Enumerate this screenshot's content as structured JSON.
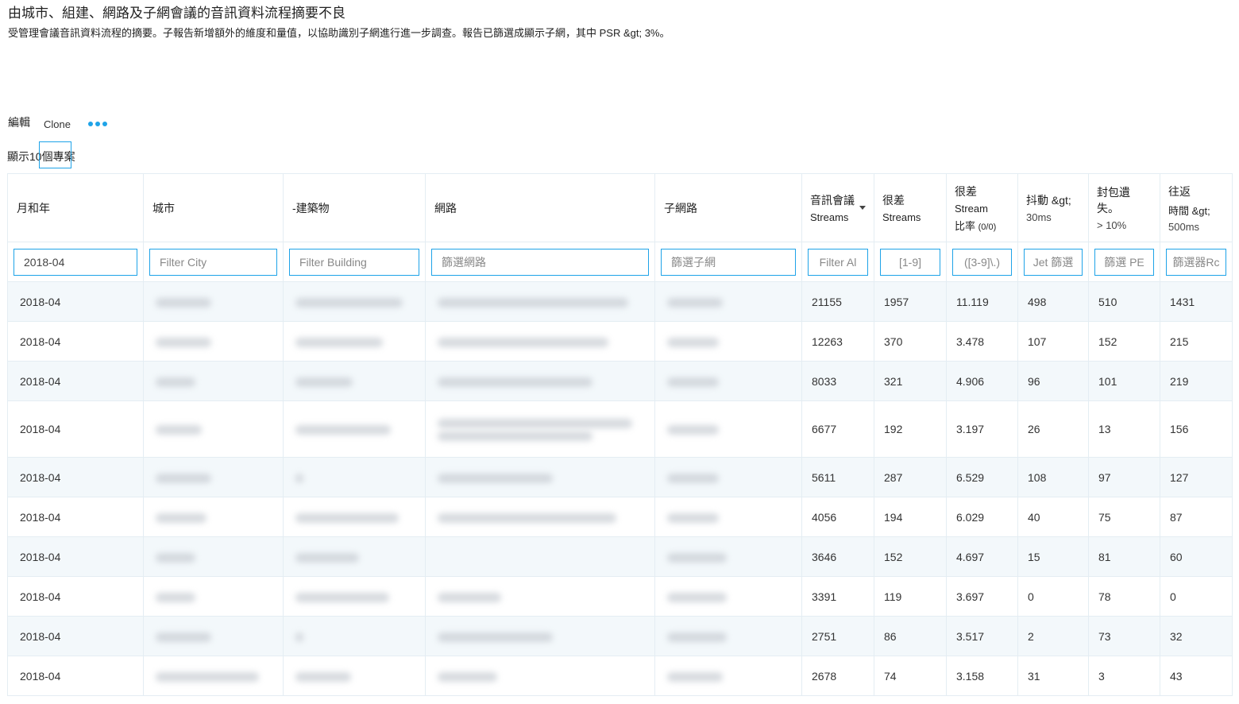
{
  "header": {
    "title": "由城市、組建、網路及子網會議的音訊資料流程摘要不良",
    "subtitle": "受管理會議音訊資料流程的摘要。子報告新增額外的維度和量值，以協助識別子網進行進一步調查。報告已篩選成顯示子網，其中 PSR &gt; 3%。"
  },
  "toolbar": {
    "edit_label": "編輯",
    "clone_label": "Clone",
    "more_icon": "ellipsis-icon"
  },
  "show_count_label": "顯示10個專案",
  "colors": {
    "accent": "#1ea3e8",
    "row_alt": "#f3f8fb",
    "border": "#e4edf3"
  },
  "table": {
    "columns": [
      {
        "label": "月和年"
      },
      {
        "label": "城市"
      },
      {
        "label": "-建築物"
      },
      {
        "label": "網路"
      },
      {
        "label": "子網路"
      },
      {
        "label": "音訊會議",
        "sub": "Streams",
        "sorted": "desc"
      },
      {
        "label": "很差",
        "sub": "Streams"
      },
      {
        "label": "很差",
        "sub": "Stream",
        "sub2": "比率",
        "sub2_small": "(0/0)"
      },
      {
        "label": "抖動 &gt;",
        "sub": "30ms"
      },
      {
        "label": "封包遺失。",
        "sub": "> 10%"
      },
      {
        "label": "往返",
        "sub": "時間 &gt;",
        "sub2": "500ms"
      }
    ],
    "filters": [
      {
        "value": "2018-04",
        "placeholder": ""
      },
      {
        "value": "",
        "placeholder": "Filter City"
      },
      {
        "value": "",
        "placeholder": "Filter Building"
      },
      {
        "value": "",
        "placeholder": "篩選網路"
      },
      {
        "value": "",
        "placeholder": "篩選子網"
      },
      {
        "value": "",
        "placeholder": "Filter Al"
      },
      {
        "value": "",
        "placeholder": "[1-9]"
      },
      {
        "value": "",
        "placeholder": "([3-9]\\.)"
      },
      {
        "value": "",
        "placeholder": "Jet 篩選"
      },
      {
        "value": "",
        "placeholder": "篩選 PE"
      },
      {
        "value": "",
        "placeholder": "篩選器Rc"
      }
    ],
    "redacted_note": "城市、建築物、網路、子網路 values are blurred in the screenshot",
    "rows": [
      {
        "month": "2018-04",
        "streams": "21155",
        "poor_streams": "1957",
        "poor_ratio": "11.119",
        "jitter": "498",
        "packet_loss": "510",
        "rtt": "1431"
      },
      {
        "month": "2018-04",
        "streams": "12263",
        "poor_streams": "370",
        "poor_ratio": "3.478",
        "jitter": "107",
        "packet_loss": "152",
        "rtt": "215"
      },
      {
        "month": "2018-04",
        "streams": "8033",
        "poor_streams": "321",
        "poor_ratio": "4.906",
        "jitter": "96",
        "packet_loss": "101",
        "rtt": "219"
      },
      {
        "month": "2018-04",
        "streams": "6677",
        "poor_streams": "192",
        "poor_ratio": "3.197",
        "jitter": "26",
        "packet_loss": "13",
        "rtt": "156"
      },
      {
        "month": "2018-04",
        "streams": "5611",
        "poor_streams": "287",
        "poor_ratio": "6.529",
        "jitter": "108",
        "packet_loss": "97",
        "rtt": "127"
      },
      {
        "month": "2018-04",
        "streams": "4056",
        "poor_streams": "194",
        "poor_ratio": "6.029",
        "jitter": "40",
        "packet_loss": "75",
        "rtt": "87"
      },
      {
        "month": "2018-04",
        "streams": "3646",
        "poor_streams": "152",
        "poor_ratio": "4.697",
        "jitter": "15",
        "packet_loss": "81",
        "rtt": "60"
      },
      {
        "month": "2018-04",
        "streams": "3391",
        "poor_streams": "119",
        "poor_ratio": "3.697",
        "jitter": "0",
        "packet_loss": "78",
        "rtt": "0"
      },
      {
        "month": "2018-04",
        "streams": "2751",
        "poor_streams": "86",
        "poor_ratio": "3.517",
        "jitter": "2",
        "packet_loss": "73",
        "rtt": "32"
      },
      {
        "month": "2018-04",
        "streams": "2678",
        "poor_streams": "74",
        "poor_ratio": "3.158",
        "jitter": "31",
        "packet_loss": "3",
        "rtt": "43"
      }
    ]
  }
}
